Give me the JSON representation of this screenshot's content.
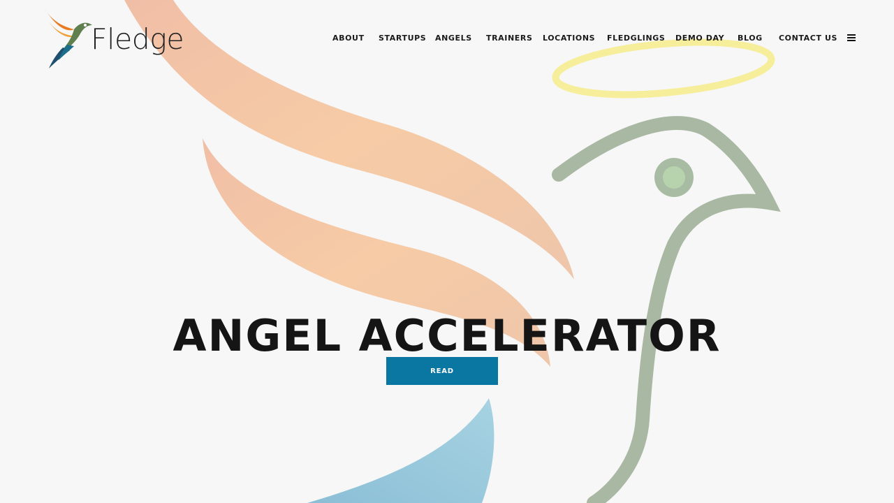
{
  "brand": {
    "name": "Fledge"
  },
  "nav": {
    "items": [
      {
        "label": "ABOUT"
      },
      {
        "label": "STARTUPS"
      },
      {
        "label": "ANGELS"
      },
      {
        "label": "TRAINERS"
      },
      {
        "label": "LOCATIONS"
      },
      {
        "label": "FLEDGLINGS"
      },
      {
        "label": "DEMO DAY"
      },
      {
        "label": "BLOG"
      },
      {
        "label": "CONTACT US"
      }
    ],
    "menu_icon": "hamburger-menu-icon"
  },
  "hero": {
    "title": "ANGEL ACCELERATOR",
    "button_label": "READ",
    "background_art": "angel-bird-illustration"
  },
  "colors": {
    "background": "#f7f7f7",
    "button": "#0a77a3",
    "wing_orange": "#f0c2a5",
    "bird_green": "#a9b8a2",
    "halo_yellow": "#f6ee9a",
    "tail_blue": "#8fc3d6",
    "text_dark": "#151515"
  }
}
